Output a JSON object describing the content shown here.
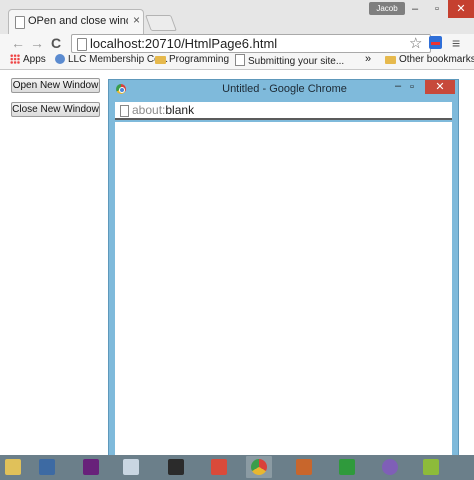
{
  "browser": {
    "tab_title": "OPen and close window u",
    "tab_close": "×",
    "profile_name": "Jacob",
    "window_controls": {
      "minimize": "–",
      "maximize": "▫",
      "close": "✕"
    },
    "nav": {
      "back": "←",
      "forward": "→",
      "reload": "C",
      "menu": "≡",
      "star": "☆"
    },
    "address": "localhost:20710/HtmlPage6.html",
    "bookmarks": [
      {
        "label": "Apps",
        "icon": "apps-grid-icon"
      },
      {
        "label": "LLC Membership Ce...",
        "icon": "globe-icon"
      },
      {
        "label": "Programming",
        "icon": "folder-icon"
      },
      {
        "label": "Submitting your site...",
        "icon": "document-icon"
      }
    ],
    "bookmarks_overflow": "»",
    "other_bookmarks": "Other bookmarks"
  },
  "page": {
    "open_button": "Open New Window",
    "close_button": "Close New Window"
  },
  "popup": {
    "title": "Untitled - Google Chrome",
    "controls": {
      "minimize": "–",
      "maximize": "▫",
      "close": "✕"
    },
    "url_scheme": "about:",
    "url_host": "blank"
  },
  "taskbar": {
    "items": [
      {
        "icon": "notepad-icon",
        "color": "#e0c15a"
      },
      {
        "icon": "paint-icon",
        "color": "#3d6aa3"
      },
      {
        "icon": "visual-studio-icon",
        "color": "#68217a"
      },
      {
        "icon": "calculator-icon",
        "color": "#c9d6e2"
      },
      {
        "icon": "microphone-icon",
        "color": "#2b2b2b"
      },
      {
        "icon": "snipping-tool-icon",
        "color": "#d94a3a"
      },
      {
        "icon": "chrome-icon",
        "color": "#4a86d8"
      },
      {
        "icon": "media-icon",
        "color": "#c8662c"
      },
      {
        "icon": "store-icon",
        "color": "#2f9a3c"
      },
      {
        "icon": "speedometer-icon",
        "color": "#7f5fb7"
      },
      {
        "icon": "android-icon",
        "color": "#8dbb3a"
      }
    ]
  },
  "colors": {
    "popup_frame": "#7fbadb",
    "close_red": "#c5402f",
    "taskbar": "#6b7f8a"
  }
}
